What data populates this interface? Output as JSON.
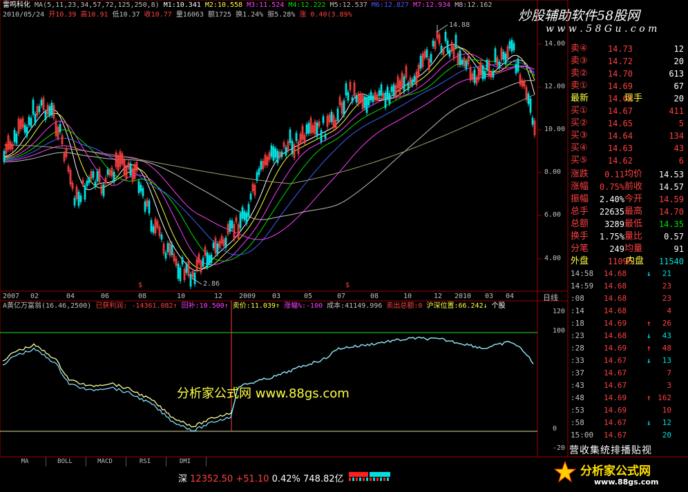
{
  "header": {
    "stock_name": "雷鸣科化",
    "ma_params": "MA(5,11,23,34,57,72,125,250,8)",
    "ma_values": [
      {
        "label": "M1:10.341",
        "color": "#ffffff"
      },
      {
        "label": "M2:10.558",
        "color": "#ffff40"
      },
      {
        "label": "M3:11.524",
        "color": "#ff40ff"
      },
      {
        "label": "M4:12.222",
        "color": "#00e000"
      },
      {
        "label": "M5:12.537",
        "color": "#c0c0c0"
      },
      {
        "label": "M6:12.827",
        "color": "#4060ff"
      },
      {
        "label": "M7:12.934",
        "color": "#ff40ff"
      },
      {
        "label": "M8:12.162",
        "color": "#c0c0c0"
      }
    ],
    "date": "2010/05/24",
    "open": "开10.39",
    "high": "高10.91",
    "low": "低10.37",
    "close": "收10.77",
    "volume": "量16063",
    "amount": "额1725",
    "turnover": "换1.24%",
    "amplitude": "振5.28%",
    "change": "涨 0.40(3.89%"
  },
  "watermark": {
    "top_right": "炒股辅助软件58股网",
    "url": "w w w . 5 8 G u . c o m",
    "center": "分析家公式网   www.88gs.com",
    "bottom_right_logo": "分析家公式网",
    "bottom_right_url": "www.88gs.com"
  },
  "price_axis": [
    "14.00",
    "12.00",
    "10.00",
    "8.00",
    "6.00",
    "4.00"
  ],
  "annotations": {
    "high": "14.88",
    "low": "2.86",
    "marker": "$"
  },
  "time_axis": [
    "2007",
    "02",
    "04",
    "06",
    "08",
    "10",
    "12",
    "2009",
    "03",
    "05",
    "07",
    "08",
    "10",
    "12",
    "2010",
    "03",
    "04"
  ],
  "period_label": "日线",
  "indicator": {
    "title": "A黄亿万富翁(16.46,2500)",
    "items": [
      {
        "label": "已获利润: -14361.082↑",
        "color": "#ff4040"
      },
      {
        "label": "回补:10.500↑",
        "color": "#ff40ff"
      },
      {
        "label": "卖价:11.039↑",
        "color": "#ffff40"
      },
      {
        "label": "涨幅%:-100",
        "color": "#ff40ff"
      },
      {
        "label": "成本:41149.996",
        "color": "#c0c0c0"
      },
      {
        "label": "卖出总额:0",
        "color": "#ff4040"
      },
      {
        "label": "沪深位置:66.242↓",
        "color": "#ffff40"
      },
      {
        "label": "个股",
        "color": "#ffffff"
      }
    ],
    "axis": [
      "120",
      "100",
      "0",
      "-20"
    ]
  },
  "quote": {
    "asks": [
      {
        "label": "卖④",
        "price": "14.73",
        "vol": "12"
      },
      {
        "label": "卖③",
        "price": "14.72",
        "vol": "20"
      },
      {
        "label": "卖②",
        "price": "14.70",
        "vol": "613"
      },
      {
        "label": "卖①",
        "price": "14.69",
        "vol": "67"
      }
    ],
    "latest": {
      "label": "最新",
      "price": "14.68",
      "label2": "现手",
      "vol": "20"
    },
    "bids": [
      {
        "label": "买①",
        "price": "14.67",
        "vol": "411"
      },
      {
        "label": "买②",
        "price": "14.65",
        "vol": "5"
      },
      {
        "label": "买③",
        "price": "14.64",
        "vol": "134"
      },
      {
        "label": "买④",
        "price": "14.63",
        "vol": "43"
      },
      {
        "label": "买⑤",
        "price": "14.62",
        "vol": "6"
      }
    ],
    "stats": [
      {
        "l1": "涨跌",
        "v1": "0.11",
        "l2": "均价",
        "v2": "14.53",
        "c1": "#ff4040",
        "c2": "#ffffff"
      },
      {
        "l1": "涨幅",
        "v1": "0.75%",
        "l2": "前收",
        "v2": "14.57",
        "c1": "#ff4040",
        "c2": "#ffffff"
      },
      {
        "l1": "振幅",
        "v1": "2.40%",
        "l2": "今开",
        "v2": "14.59",
        "c1": "#ffffff",
        "c2": "#ff4040"
      },
      {
        "l1": "总手",
        "v1": "22635",
        "l2": "最高",
        "v2": "14.70",
        "c1": "#ffffff",
        "c2": "#ff4040"
      },
      {
        "l1": "总额",
        "v1": "3289",
        "l2": "最低",
        "v2": "14.35",
        "c1": "#ffffff",
        "c2": "#00e000"
      },
      {
        "l1": "换手",
        "v1": "1.75%",
        "l2": "量比",
        "v2": "0.57",
        "c1": "#ffffff",
        "c2": "#ffffff"
      },
      {
        "l1": "分笔",
        "v1": "249",
        "l2": "均量",
        "v2": "91",
        "c1": "#ffffff",
        "c2": "#ffffff"
      }
    ],
    "outer": {
      "label": "外盘",
      "vol": "11095"
    },
    "inner": {
      "label": "内盘",
      "vol": "11540"
    }
  },
  "ticks": [
    {
      "t": "14:58",
      "p": "14.68",
      "a": "↓",
      "v": "21",
      "pc": "#ff4040",
      "ac": "#00e0e0",
      "vc": "#00e0e0"
    },
    {
      "t": "14:59",
      "p": "14.68",
      "a": "",
      "v": "23",
      "pc": "#ff4040",
      "ac": "",
      "vc": "#ff4040"
    },
    {
      "t": ":08",
      "p": "14.68",
      "a": "",
      "v": "23",
      "pc": "#ff4040",
      "ac": "",
      "vc": "#ff4040"
    },
    {
      "t": ":14",
      "p": "14.68",
      "a": "",
      "v": "4",
      "pc": "#ff4040",
      "ac": "",
      "vc": "#ff4040"
    },
    {
      "t": ":18",
      "p": "14.69",
      "a": "↑",
      "v": "26",
      "pc": "#ff4040",
      "ac": "#ff4040",
      "vc": "#ff4040"
    },
    {
      "t": ":23",
      "p": "14.68",
      "a": "↓",
      "v": "43",
      "pc": "#ff4040",
      "ac": "#00e0e0",
      "vc": "#00e0e0"
    },
    {
      "t": ":28",
      "p": "14.69",
      "a": "↑",
      "v": "48",
      "pc": "#ff4040",
      "ac": "#ff4040",
      "vc": "#ff4040"
    },
    {
      "t": ":33",
      "p": "14.67",
      "a": "↓",
      "v": "13",
      "pc": "#ff4040",
      "ac": "#00e0e0",
      "vc": "#00e0e0"
    },
    {
      "t": ":37",
      "p": "14.67",
      "a": "",
      "v": "7",
      "pc": "#ff4040",
      "ac": "",
      "vc": "#ff4040"
    },
    {
      "t": ":43",
      "p": "14.67",
      "a": "",
      "v": "3",
      "pc": "#ff4040",
      "ac": "",
      "vc": "#ff4040"
    },
    {
      "t": ":48",
      "p": "14.69",
      "a": "↑",
      "v": "162",
      "pc": "#ff4040",
      "ac": "#ff4040",
      "vc": "#ff4040"
    },
    {
      "t": ":53",
      "p": "14.69",
      "a": "",
      "v": "10",
      "pc": "#ff4040",
      "ac": "",
      "vc": "#ff4040"
    },
    {
      "t": ":58",
      "p": "14.67",
      "a": "↓",
      "v": "12",
      "pc": "#ff4040",
      "ac": "#00e0e0",
      "vc": "#00e0e0"
    },
    {
      "t": "15:00",
      "p": "14.67",
      "a": "",
      "v": "20",
      "pc": "#ff4040",
      "ac": "",
      "vc": "#00e0e0"
    }
  ],
  "side_tabs": "营收集统排播贴视",
  "bottom_tabs": [
    "MA",
    "BOLL",
    "MACD",
    "RSI",
    "DMI"
  ],
  "status": {
    "market": "深",
    "index": "12352.50",
    "change": "+51.10",
    "pct": "0.42%",
    "amount": "748.82亿"
  },
  "colors": {
    "bg": "#000000",
    "red": "#ff4040",
    "green": "#00e000",
    "cyan": "#00e0e0",
    "yellow": "#ffff40",
    "magenta": "#ff40ff",
    "grid": "#a00000"
  }
}
